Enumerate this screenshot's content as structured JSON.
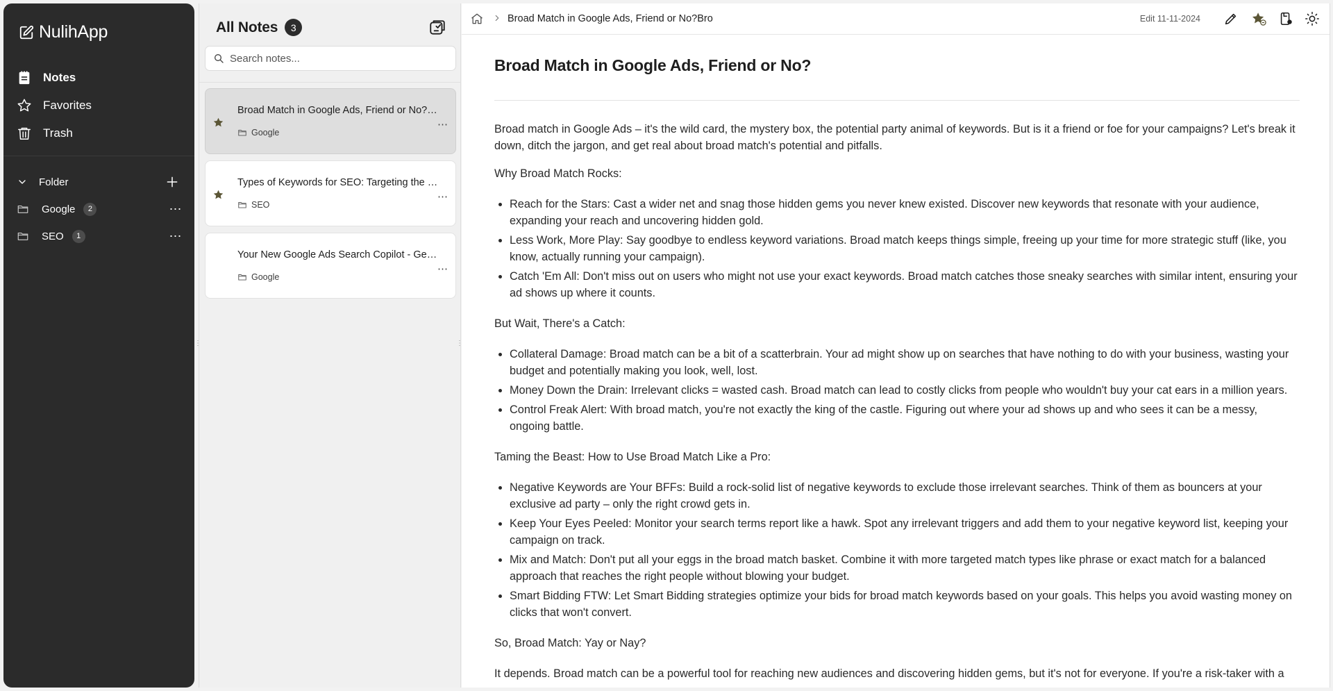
{
  "app": {
    "name": "NulihApp",
    "accent": "#2b2b2b"
  },
  "nav": [
    {
      "label": "Notes",
      "icon": "notes-icon"
    },
    {
      "label": "Favorites",
      "icon": "star-outline-icon"
    },
    {
      "label": "Trash",
      "icon": "trash-icon"
    }
  ],
  "folders": {
    "heading": "Folder",
    "items": [
      {
        "name": "Google",
        "count": "2"
      },
      {
        "name": "SEO",
        "count": "1"
      }
    ]
  },
  "notes_list": {
    "title": "All Notes",
    "count": "3",
    "search_placeholder": "Search notes...",
    "items": [
      {
        "title": "Broad Match in Google Ads, Friend or No?Bro",
        "folder": "Google",
        "favorite": true,
        "selected": true
      },
      {
        "title": "Types of Keywords for SEO: Targeting the Right Words",
        "folder": "SEO",
        "favorite": true,
        "selected": false
      },
      {
        "title": "Your New Google Ads Search Copilot - Gemini",
        "folder": "Google",
        "favorite": false,
        "selected": false
      }
    ]
  },
  "editor": {
    "breadcrumb_title": "Broad Match in Google Ads, Friend or No?Bro",
    "edit_date": "Edit 11-11-2024",
    "doc_title": "Broad Match in Google Ads, Friend or No?",
    "intro": "Broad match in Google Ads – it's the wild card, the mystery box, the potential party animal of keywords. But is it a friend or foe for your campaigns? Let's break it down, ditch the jargon, and get real about broad match's potential and pitfalls.",
    "sections": [
      {
        "heading": "Why Broad Match Rocks:",
        "items": [
          "Reach for the Stars: Cast a wider net and snag those hidden gems you never knew existed. Discover new keywords that resonate with your audience, expanding your reach and uncovering hidden gold.",
          "Less Work, More Play: Say goodbye to endless keyword variations. Broad match keeps things simple, freeing up your time for more strategic stuff (like, you know, actually running your campaign).",
          "Catch 'Em All: Don't miss out on users who might not use your exact keywords. Broad match catches those sneaky searches with similar intent, ensuring your ad shows up where it counts."
        ]
      },
      {
        "heading": "But Wait, There's a Catch:",
        "items": [
          "Collateral Damage: Broad match can be a bit of a scatterbrain. Your ad might show up on searches that have nothing to do with your business, wasting your budget and potentially making you look, well, lost.",
          "Money Down the Drain: Irrelevant clicks = wasted cash. Broad match can lead to costly clicks from people who wouldn't buy your cat ears in a million years.",
          "Control Freak Alert: With broad match, you're not exactly the king of the castle. Figuring out where your ad shows up and who sees it can be a messy, ongoing battle."
        ]
      },
      {
        "heading": "Taming the Beast: How to Use Broad Match Like a Pro:",
        "items": [
          "Negative Keywords are Your BFFs: Build a rock-solid list of negative keywords to exclude those irrelevant searches. Think of them as bouncers at your exclusive ad party – only the right crowd gets in.",
          "Keep Your Eyes Peeled: Monitor your search terms report like a hawk. Spot any irrelevant triggers and add them to your negative keyword list, keeping your campaign on track.",
          "Mix and Match: Don't put all your eggs in the broad match basket. Combine it with more targeted match types like phrase or exact match for a balanced approach that reaches the right people without blowing your budget.",
          "Smart Bidding FTW: Let Smart Bidding strategies optimize your bids for broad match keywords based on your goals. This helps you avoid wasting money on clicks that won't convert."
        ]
      },
      {
        "heading": "So, Broad Match: Yay or Nay?",
        "items": []
      }
    ],
    "closing": "It depends. Broad match can be a powerful tool for reaching new audiences and discovering hidden gems, but it's not for everyone. If you're a risk-taker with a"
  }
}
